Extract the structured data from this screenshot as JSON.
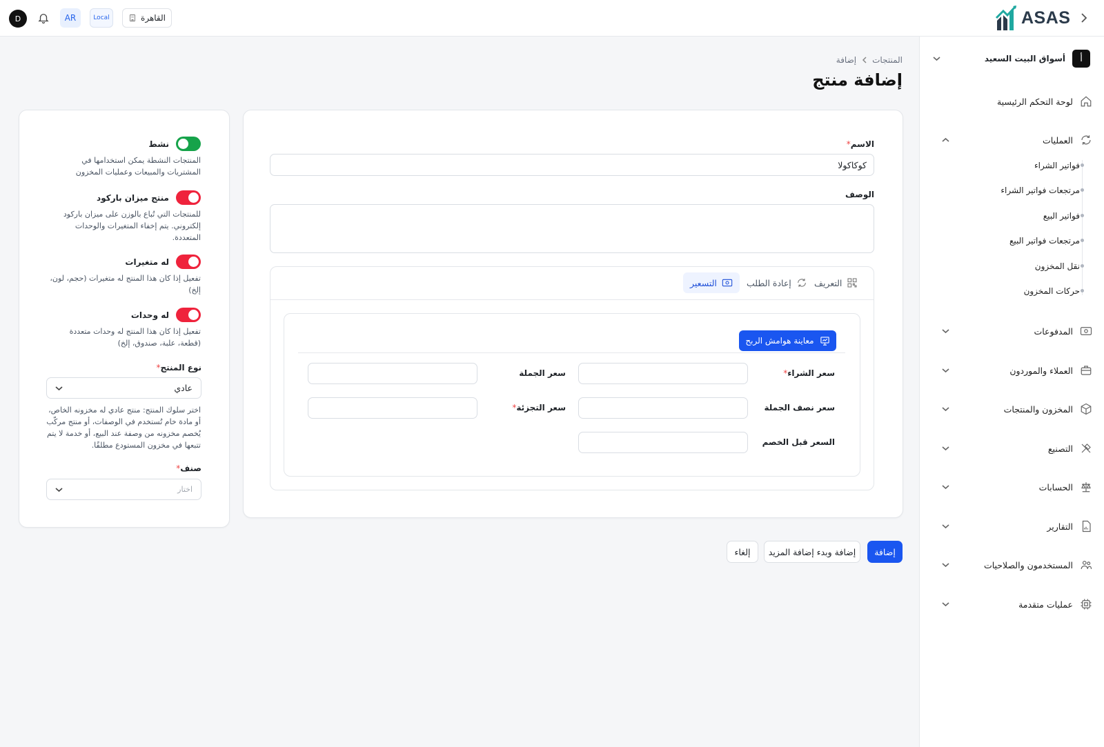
{
  "topbar": {
    "avatar_initial": "D",
    "lang": "AR",
    "env": "Local",
    "branch": "القاهرة",
    "logo": "ASAS"
  },
  "sidebar": {
    "store_initial": "أ",
    "store_name": "أسواق البيت السعيد",
    "items": [
      {
        "label": "لوحة التحكم الرئيسية",
        "icon": "home-icon"
      },
      {
        "label": "العمليات",
        "icon": "refresh-icon"
      },
      {
        "label": "المدفوعات",
        "icon": "payment-icon"
      },
      {
        "label": "العملاء والموردون",
        "icon": "briefcase-icon"
      },
      {
        "label": "المخزون والمنتجات",
        "icon": "box-icon"
      },
      {
        "label": "التصنيع",
        "icon": "tools-icon"
      },
      {
        "label": "الحسابات",
        "icon": "scale-icon"
      },
      {
        "label": "التقارير",
        "icon": "report-icon"
      },
      {
        "label": "المستخدمون والصلاحيات",
        "icon": "users-icon"
      },
      {
        "label": "عمليات متقدمة",
        "icon": "chip-icon"
      }
    ],
    "sub_items": [
      "فواتير الشراء",
      "مرتجعات فواتير الشراء",
      "فواتير البيع",
      "مرتجعات فواتير البيع",
      "نقل المخزون",
      "حركات المخزون"
    ]
  },
  "header": {
    "breadcrumb_root": "المنتجات",
    "breadcrumb_current": "إضافة",
    "title": "إضافة منتج"
  },
  "settings": {
    "active_label": "نشط",
    "active_help": "المنتجات النشطة يمكن استخدامها في المشتريات والمبيعات وعمليات المخزون",
    "scale_label": "منتج ميزان باركود",
    "scale_help": "للمنتجات التي تُباع بالوزن على ميزان باركود إلكتروني. يتم إخفاء المتغيرات والوحدات المتعددة.",
    "variants_label": "له متغيرات",
    "variants_help": "تفعيل إذا كان هذا المنتج له متغيرات (حجم، لون، إلخ)",
    "units_label": "له وحدات",
    "units_help": "تفعيل إذا كان هذا المنتج له وحدات متعددة (قطعة، علبة، صندوق، إلخ)",
    "type_label": "نوع المنتج",
    "type_value": "عادي",
    "type_help": "اختر سلوك المنتج: منتج عادي له مخزونه الخاص، أو مادة خام تُستخدم في الوصفات، أو منتج مركّب يُخصم مخزونه من وصفة عند البيع، أو خدمة لا يتم تتبعها في مخزون المستودع مطلقًا.",
    "category_label": "صنف",
    "category_placeholder": "اختار"
  },
  "form": {
    "name_label": "الاسم",
    "name_value": "كوكاكولا",
    "description_label": "الوصف",
    "tabs": [
      "التعريف",
      "إعادة الطلب",
      "التسعير"
    ],
    "preview_button": "معاينة هوامش الربح",
    "purchase_price": "سعر الشراء",
    "wholesale_price": "سعر الجملة",
    "half_wholesale_price": "سعر نصف الجملة",
    "retail_price": "سعر التجزئة",
    "pre_discount_price": "السعر قبل الخصم"
  },
  "actions": {
    "add": "إضافة",
    "add_more": "إضافة وبدء إضافة المزيد",
    "cancel": "إلغاء"
  },
  "colors": {
    "primary": "#1a56f0",
    "toggle_on_green": "#16a34a",
    "toggle_on_red": "#ef233c"
  }
}
